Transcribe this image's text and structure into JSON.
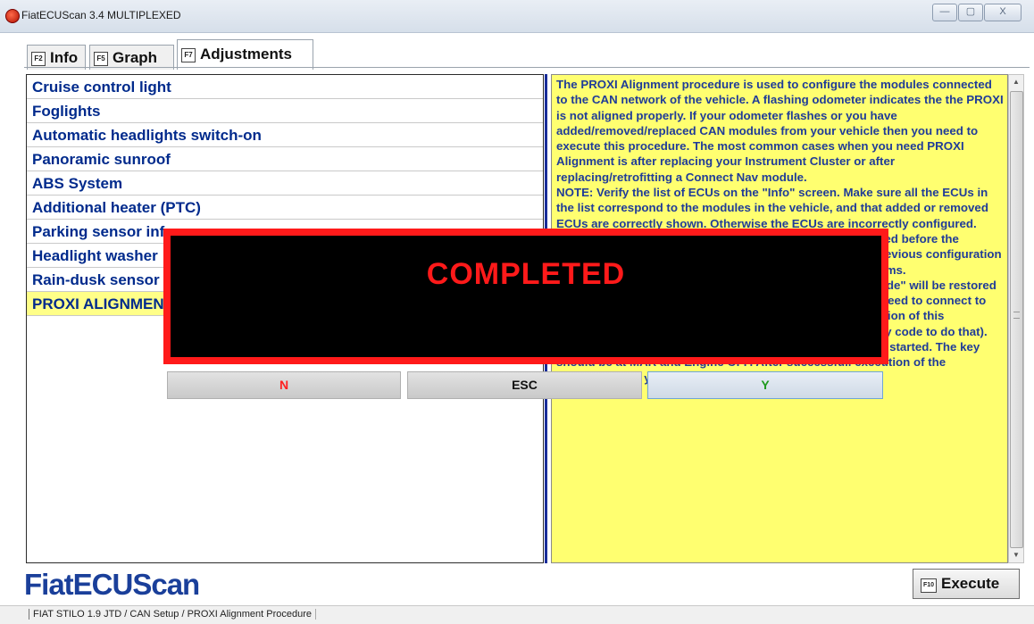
{
  "window": {
    "title": "FiatECUScan 3.4 MULTIPLEXED",
    "min_label": "—",
    "max_label": "▢",
    "close_label": "X"
  },
  "tabs": [
    {
      "key": "F2",
      "label": "Info"
    },
    {
      "key": "F5",
      "label": "Graph"
    },
    {
      "key": "F7",
      "label": "Adjustments"
    }
  ],
  "adjustments": [
    "Cruise control light",
    "Foglights",
    "Automatic headlights switch-on",
    "Panoramic sunroof",
    "ABS System",
    "Additional heater (PTC)",
    "Parking sensor info on screen",
    "Headlight washer",
    "Rain-dusk sensor",
    "PROXI ALIGNMENT"
  ],
  "selected_index": 9,
  "description": "The PROXI Alignment procedure is used to configure the modules connected to the CAN network of the vehicle. A flashing odometer indicates the the PROXI is not aligned properly. If your odometer flashes or you have added/removed/replaced CAN modules from your vehicle then you need to execute this procedure. The most common cases when you need PROXI Alignment is after replacing your Instrument Cluster or after replacing/retrofitting a Connect Nav module.\nNOTE: Verify the list of ECUs on the \"Info\" screen. Make sure all the ECUs in the list correspond to the modules in the vehicle, and that added or removed ECUs are correctly shown. Otherwise the ECUs are incorrectly configured.\nA backup of the configuration to the files folder is performed before the procedure. It has some important information about the previous configuration and you can use it to restore the settings in case of problems.\nNOTE: The \"Indicators Command\" and \"Alarm Country Mode\" will be restored to the factory default value after this procedure. You may need to connect to the Body Computer and correct these settings after execution of this procedure (you need to know your vehicle's 5-digit security code to do that).\nWARNING: DO NOT INTERRUPT the procedure once it has started. The key should be at MAR and Engine OFF. After successfull execution of the procedure turn your key to OFF",
  "modal": {
    "message": "COMPLETED",
    "btn_n": "N",
    "btn_esc": "ESC",
    "btn_y": "Y"
  },
  "logo": "FiatECUScan",
  "execute": {
    "key": "F10",
    "label": "Execute"
  },
  "status": "FIAT STILO 1.9 JTD / CAN Setup / PROXI Alignment Procedure",
  "colors": {
    "list_text": "#002a8c",
    "desc_bg": "#ffff70",
    "modal_border": "#ff1a1a",
    "btn_n": "#ff2020",
    "btn_y": "#1e9a1e"
  }
}
